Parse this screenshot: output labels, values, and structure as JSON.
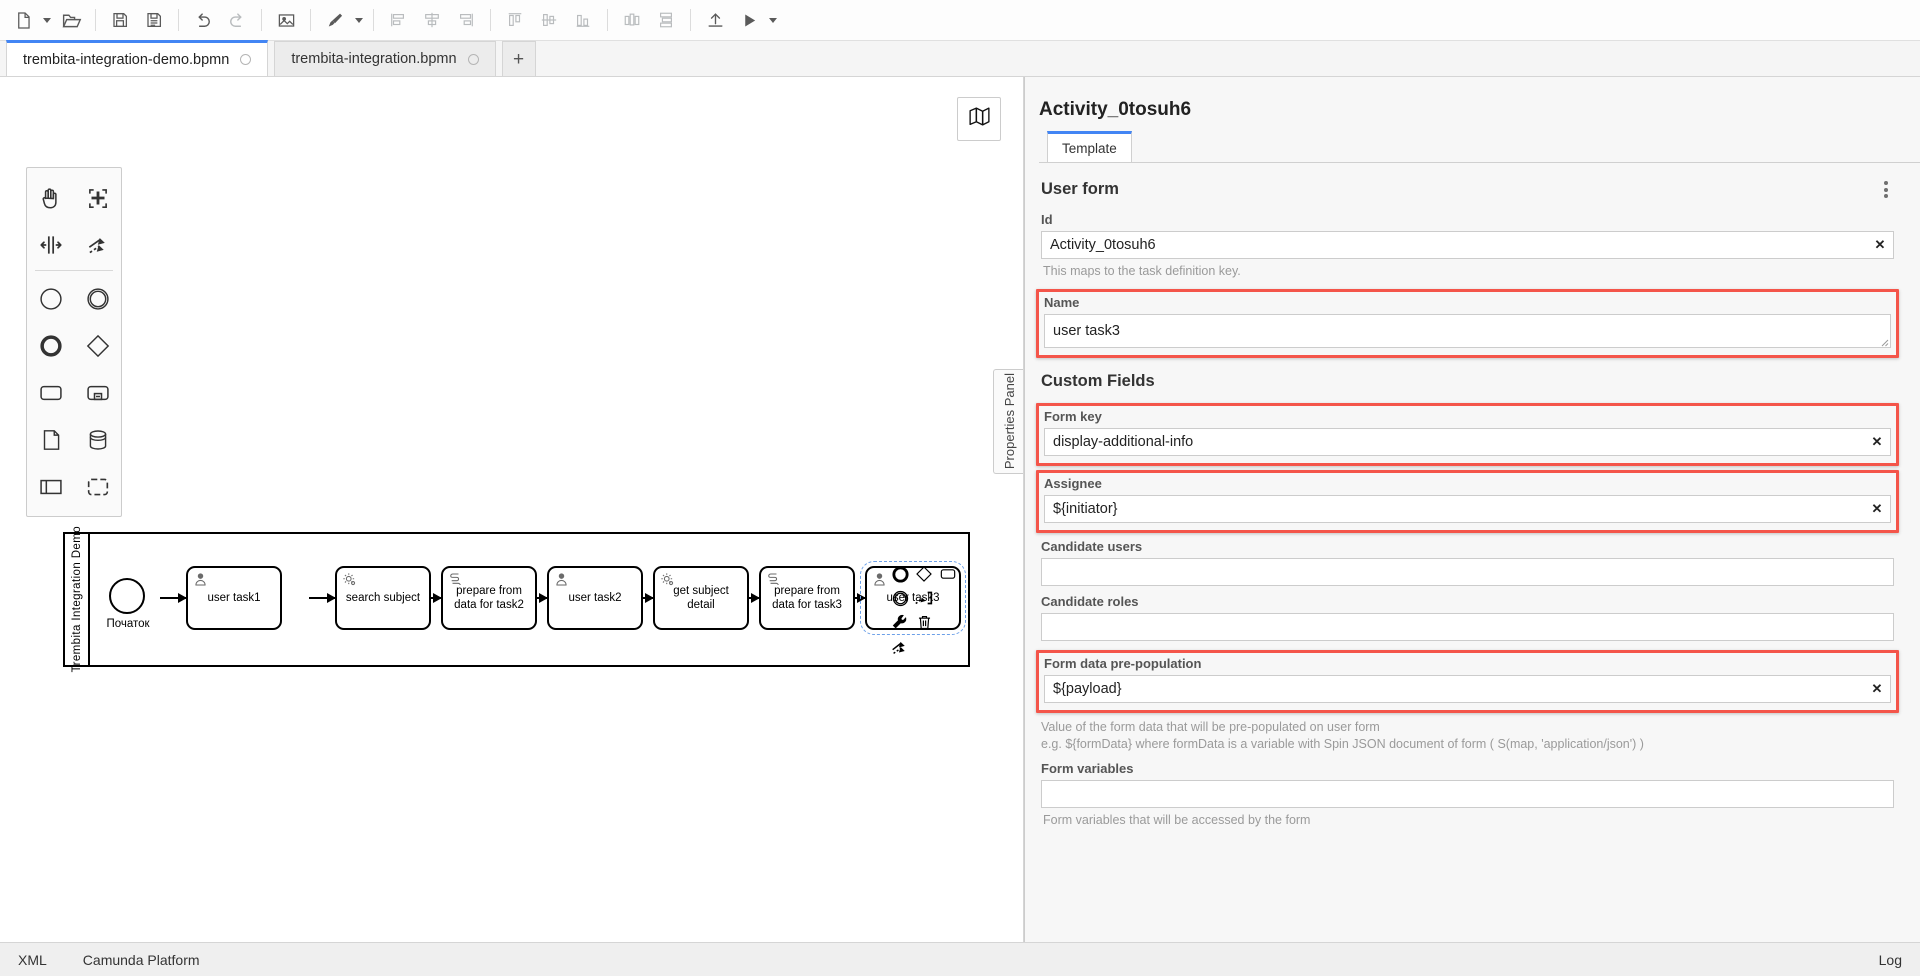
{
  "toolbar": {
    "buttons": [
      {
        "name": "new-diagram-icon",
        "label": "New"
      },
      {
        "name": "new-diagram-caret-icon",
        "label": ""
      },
      {
        "name": "open-folder-icon",
        "label": "Open"
      },
      {
        "name": "save-icon",
        "label": "Save"
      },
      {
        "name": "save-as-icon",
        "label": "Save As"
      },
      {
        "name": "undo-icon",
        "label": "Undo"
      },
      {
        "name": "redo-icon",
        "label": "Redo"
      },
      {
        "name": "export-image-icon",
        "label": "Export as image"
      },
      {
        "name": "paintbrush-icon",
        "label": "Set color"
      },
      {
        "name": "paintbrush-caret-icon",
        "label": ""
      },
      {
        "name": "align-left-icon",
        "label": "Align left"
      },
      {
        "name": "align-center-icon",
        "label": "Align center"
      },
      {
        "name": "align-right-icon",
        "label": "Align right"
      },
      {
        "name": "align-top-icon",
        "label": "Align top"
      },
      {
        "name": "align-middle-icon",
        "label": "Align middle"
      },
      {
        "name": "align-bottom-icon",
        "label": "Align bottom"
      },
      {
        "name": "distribute-horizontal-icon",
        "label": "Distribute horizontally"
      },
      {
        "name": "distribute-vertical-icon",
        "label": "Distribute vertically"
      },
      {
        "name": "deploy-icon",
        "label": "Deploy"
      },
      {
        "name": "run-icon",
        "label": "Start instance"
      },
      {
        "name": "run-caret-icon",
        "label": ""
      }
    ]
  },
  "tabs": {
    "items": [
      {
        "label": "trembita-integration-demo.bpmn",
        "active": true,
        "dirty": true
      },
      {
        "label": "trembita-integration.bpmn",
        "active": false,
        "dirty": true
      }
    ],
    "add_label": "+"
  },
  "canvas": {
    "minimap_label": "Toggle minimap",
    "palette": [
      {
        "name": "hand-tool-icon",
        "label": "Activate hand tool"
      },
      {
        "name": "lasso-tool-icon",
        "label": "Activate lasso tool"
      },
      {
        "name": "space-tool-icon",
        "label": "Activate create/remove space tool"
      },
      {
        "name": "global-connect-tool-icon",
        "label": "Activate global connect tool"
      },
      {
        "name": "start-event-icon",
        "label": "Create StartEvent"
      },
      {
        "name": "intermediate-event-icon",
        "label": "Create Intermediate/Boundary Event"
      },
      {
        "name": "end-event-icon",
        "label": "Create EndEvent"
      },
      {
        "name": "gateway-icon",
        "label": "Create Gateway"
      },
      {
        "name": "task-icon",
        "label": "Create Task"
      },
      {
        "name": "subprocess-collapsed-icon",
        "label": "Create collapsed SubProcess"
      },
      {
        "name": "data-object-icon",
        "label": "Create DataObjectReference"
      },
      {
        "name": "data-store-icon",
        "label": "Create DataStoreReference"
      },
      {
        "name": "participant-icon",
        "label": "Create Pool/Participant"
      },
      {
        "name": "group-icon",
        "label": "Create Group"
      }
    ],
    "properties_panel_toggle": "Properties Panel",
    "context_pad": [
      {
        "name": "append-end-event-icon",
        "label": "Append EndEvent"
      },
      {
        "name": "append-gateway-icon",
        "label": "Append Gateway"
      },
      {
        "name": "append-task-icon",
        "label": "Append Task"
      },
      {
        "name": "append-intermediate-event-icon",
        "label": "Append Intermediate/Boundary Event"
      },
      {
        "name": "connect-icon",
        "label": "Connect using Sequence/MessageFlow"
      },
      {
        "name": "change-type-icon",
        "label": "Change type"
      },
      {
        "name": "delete-icon",
        "label": "Remove"
      },
      {
        "name": "append-text-annotation-icon",
        "label": "Append TextAnnotation"
      }
    ]
  },
  "diagram": {
    "pool_label": "Trembita Integration Demo",
    "start_event_label": "Початок",
    "nodes": [
      {
        "label": "user task1",
        "type": "user"
      },
      {
        "label": "search subject",
        "type": "service"
      },
      {
        "label": "prepare from data for task2",
        "type": "script"
      },
      {
        "label": "user task2",
        "type": "user"
      },
      {
        "label": "get subject detail",
        "type": "service"
      },
      {
        "label": "prepare from data for task3",
        "type": "script"
      },
      {
        "label": "user task3",
        "type": "user",
        "selected": true
      }
    ]
  },
  "properties": {
    "title": "Activity_0tosuh6",
    "tabs": [
      {
        "label": "Template",
        "active": true
      }
    ],
    "group_title": "User form",
    "kebab_label": "More options",
    "section_custom_fields": "Custom Fields",
    "fields": [
      {
        "label": "Id",
        "value": "Activity_0tosuh6",
        "help": "This maps to the task definition key.",
        "clearable": true,
        "highlighted": false,
        "kind": "input"
      },
      {
        "label": "Name",
        "value": "user task3",
        "help": "",
        "clearable": false,
        "highlighted": true,
        "kind": "textarea"
      },
      {
        "label": "Form key",
        "value": "display-additional-info",
        "help": "",
        "clearable": true,
        "highlighted": true,
        "kind": "input"
      },
      {
        "label": "Assignee",
        "value": "${initiator}",
        "help": "",
        "clearable": true,
        "highlighted": true,
        "kind": "input"
      },
      {
        "label": "Candidate users",
        "value": "",
        "help": "",
        "clearable": false,
        "highlighted": false,
        "kind": "input"
      },
      {
        "label": "Candidate roles",
        "value": "",
        "help": "",
        "clearable": false,
        "highlighted": false,
        "kind": "input"
      },
      {
        "label": "Form data pre-population",
        "value": "${payload}",
        "help": "Value of the form data that will be pre-populated on user form\ne.g. ${formData} where formData is a variable with Spin JSON document of form ( S(map, 'application/json') )",
        "clearable": true,
        "highlighted": true,
        "kind": "input"
      },
      {
        "label": "Form variables",
        "value": "",
        "help": "Form variables that will be accessed by the form",
        "clearable": false,
        "highlighted": false,
        "kind": "input"
      }
    ],
    "accent_highlight_color": "#f4554a",
    "accent_tab_color": "#4285f4"
  },
  "footer": {
    "xml_label": "XML",
    "platform_label": "Camunda Platform",
    "log_label": "Log"
  }
}
